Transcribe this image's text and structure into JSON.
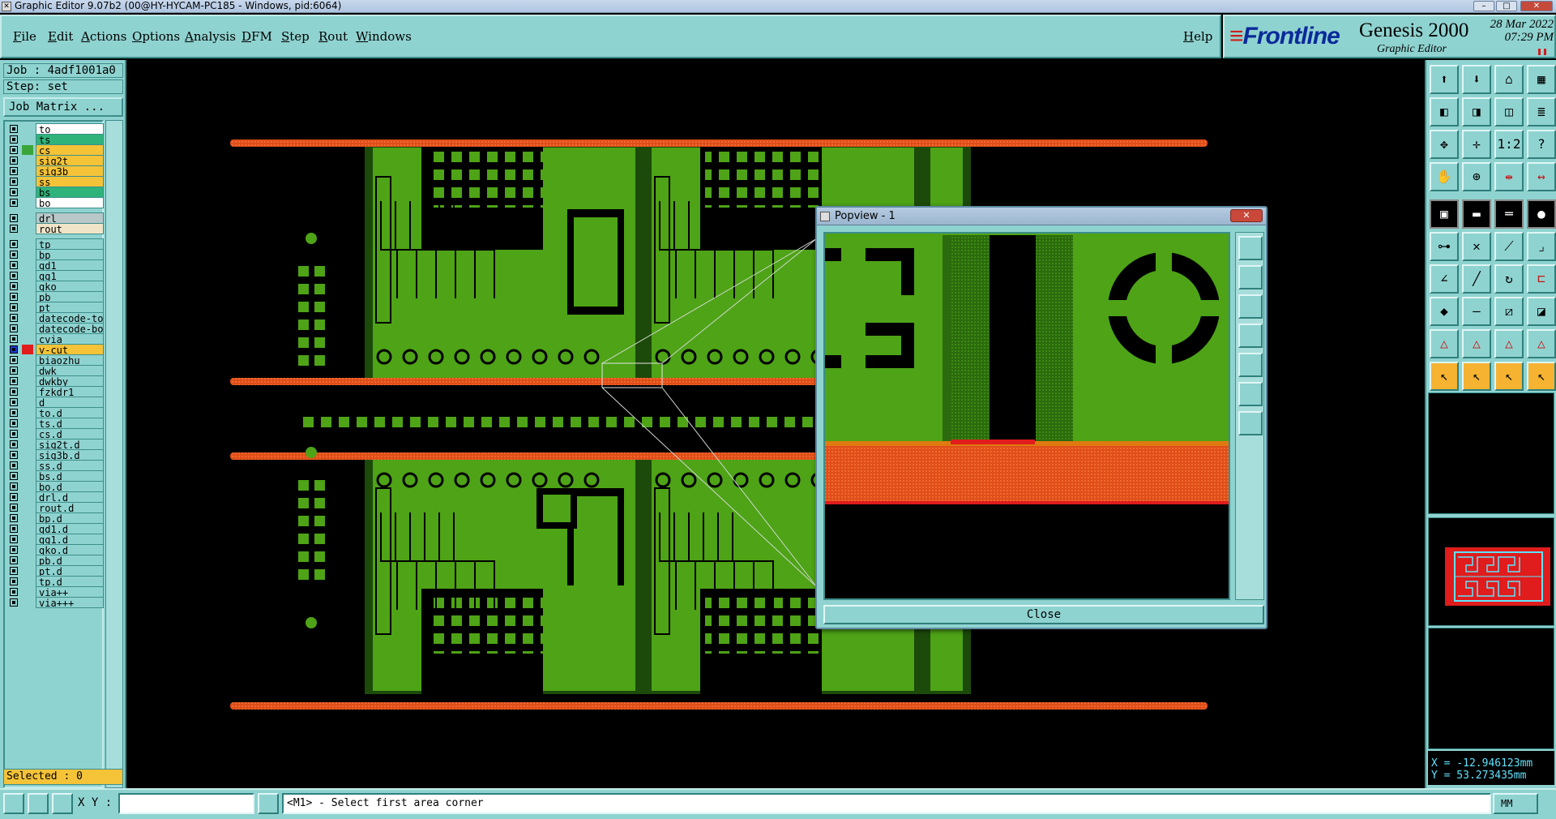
{
  "window": {
    "title": "Graphic Editor 9.07b2 (00@HY-HYCAM-PC185 - Windows, pid:6064)"
  },
  "menu": {
    "items": [
      "File",
      "Edit",
      "Actions",
      "Options",
      "Analysis",
      "DFM",
      "Step",
      "Rout",
      "Windows"
    ],
    "help": "Help"
  },
  "brand": {
    "logo_prefix": "≡",
    "logo": "Frontline",
    "product": "Genesis 2000",
    "subtitle": "Graphic Editor",
    "date": "28 Mar 2022",
    "time": "07:29 PM"
  },
  "job": {
    "job_label": "Job : 4adf1001a0",
    "step_label": "Step: set",
    "matrix_button": "Job Matrix ..."
  },
  "layers": [
    {
      "name": "to",
      "color": "#ffffff",
      "swatch": ""
    },
    {
      "name": "ts",
      "color": "#2fb37a",
      "swatch": ""
    },
    {
      "name": "cs",
      "color": "#f5c338",
      "swatch": "#3aa53a"
    },
    {
      "name": "sig2t",
      "color": "#f5c338",
      "swatch": ""
    },
    {
      "name": "sig3b",
      "color": "#f5c338",
      "swatch": ""
    },
    {
      "name": "ss",
      "color": "#f5c338",
      "swatch": ""
    },
    {
      "name": "bs",
      "color": "#2fb37a",
      "swatch": ""
    },
    {
      "name": "bo",
      "color": "#ffffff",
      "swatch": ""
    },
    {
      "name": "drl",
      "color": "#b8c8c8",
      "swatch": ""
    },
    {
      "name": "rout",
      "color": "#f0e4c8",
      "swatch": ""
    },
    {
      "name": "tp",
      "color": "",
      "swatch": ""
    },
    {
      "name": "bp",
      "color": "",
      "swatch": ""
    },
    {
      "name": "gd1",
      "color": "",
      "swatch": ""
    },
    {
      "name": "gg1",
      "color": "",
      "swatch": ""
    },
    {
      "name": "gko",
      "color": "",
      "swatch": ""
    },
    {
      "name": "pb",
      "color": "",
      "swatch": ""
    },
    {
      "name": "pt",
      "color": "",
      "swatch": ""
    },
    {
      "name": "datecode-to",
      "color": "",
      "swatch": ""
    },
    {
      "name": "datecode-bo",
      "color": "",
      "swatch": ""
    },
    {
      "name": "cvia",
      "color": "",
      "swatch": ""
    },
    {
      "name": "v-cut",
      "color": "#f5c338",
      "swatch": "#e01c1c",
      "active": true
    },
    {
      "name": "biaozhu",
      "color": "",
      "swatch": ""
    },
    {
      "name": "dwk",
      "color": "",
      "swatch": ""
    },
    {
      "name": "dwkby",
      "color": "",
      "swatch": ""
    },
    {
      "name": "fzkdr1",
      "color": "",
      "swatch": ""
    },
    {
      "name": "d",
      "color": "",
      "swatch": ""
    },
    {
      "name": "to.d",
      "color": "",
      "swatch": ""
    },
    {
      "name": "ts.d",
      "color": "",
      "swatch": ""
    },
    {
      "name": "cs.d",
      "color": "",
      "swatch": ""
    },
    {
      "name": "sig2t.d",
      "color": "",
      "swatch": ""
    },
    {
      "name": "sig3b.d",
      "color": "",
      "swatch": ""
    },
    {
      "name": "ss.d",
      "color": "",
      "swatch": ""
    },
    {
      "name": "bs.d",
      "color": "",
      "swatch": ""
    },
    {
      "name": "bo.d",
      "color": "",
      "swatch": ""
    },
    {
      "name": "drl.d",
      "color": "",
      "swatch": ""
    },
    {
      "name": "rout.d",
      "color": "",
      "swatch": ""
    },
    {
      "name": "bp.d",
      "color": "",
      "swatch": ""
    },
    {
      "name": "gd1.d",
      "color": "",
      "swatch": ""
    },
    {
      "name": "gg1.d",
      "color": "",
      "swatch": ""
    },
    {
      "name": "gko.d",
      "color": "",
      "swatch": ""
    },
    {
      "name": "pb.d",
      "color": "",
      "swatch": ""
    },
    {
      "name": "pt.d",
      "color": "",
      "swatch": ""
    },
    {
      "name": "tp.d",
      "color": "",
      "swatch": ""
    },
    {
      "name": "via++",
      "color": "",
      "swatch": ""
    },
    {
      "name": "via+++",
      "color": "",
      "swatch": ""
    }
  ],
  "selected": "Selected : 0",
  "colors": {
    "panel": "#8fd3d0",
    "board_green": "#4ea316",
    "copper_dark": "#1c4a0a",
    "vcut": "#e04e1a",
    "coords": "#5fe3ff"
  },
  "popview": {
    "title": "Popview - 1",
    "close_label": "Close"
  },
  "coords": {
    "x": "X = -12.946123mm",
    "y": "Y = 53.273435mm"
  },
  "status": {
    "xy_label": "X Y :",
    "xy_value": "",
    "message": "<M1> - Select first area corner",
    "units": "MM"
  },
  "toolbar_icons": [
    "save-icon",
    "load-icon",
    "home-icon",
    "grid-icon",
    "snap-left-icon",
    "snap-right-icon",
    "split-icon",
    "layers-icon",
    "fit-icon",
    "center-icon",
    "ratio-icon",
    "help-icon",
    "pan-icon",
    "zoom-icon",
    "measure-red-icon",
    "measure-icon",
    "pad-icon",
    "line-icon",
    "ruler-icon",
    "drill-icon",
    "node-icon",
    "cross-icon",
    "connect-icon",
    "edge-icon",
    "angle-icon",
    "slash-icon",
    "arc-icon",
    "fit-red-icon",
    "dot-icon",
    "minus-icon",
    "bracket-icon",
    "window-icon",
    "tri1-icon",
    "tri2-icon",
    "tri3-icon",
    "tri4-icon",
    "pointer-icon",
    "pointer-red-icon",
    "pointer-blue-icon",
    "pointer-multi-icon"
  ]
}
